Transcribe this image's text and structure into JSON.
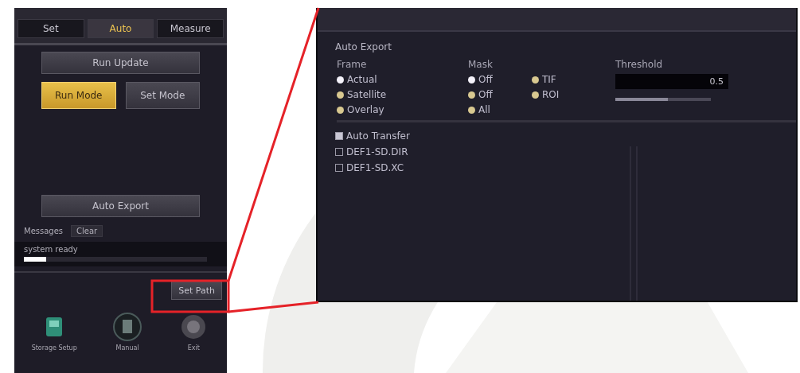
{
  "left_panel": {
    "tabs": [
      {
        "label": "Set",
        "selected": false
      },
      {
        "label": "Auto",
        "selected": true
      },
      {
        "label": "Measure",
        "selected": false
      }
    ],
    "run_button": "Run Update",
    "mode_buttons": [
      {
        "label": "Run Mode",
        "selected": true
      },
      {
        "label": "Set Mode",
        "selected": false
      }
    ],
    "export_button": "Auto Export",
    "messages": {
      "label": "Messages",
      "clear": "Clear",
      "text": "system ready",
      "level": 0.12
    },
    "path_button": "Set Path",
    "tools": [
      {
        "label": "Storage Setup",
        "kind": "storage"
      },
      {
        "label": "Manual",
        "kind": "manual"
      },
      {
        "label": "Exit",
        "kind": "exit"
      }
    ]
  },
  "callout": {
    "title": "Auto Export",
    "frame": {
      "label": "Frame",
      "options": [
        {
          "label": "Actual",
          "selected": true
        },
        {
          "label": "Satellite",
          "selected": false
        },
        {
          "label": "Overlay",
          "selected": false
        }
      ]
    },
    "mask": {
      "label": "Mask",
      "options": [
        {
          "label": "Off",
          "selected": true
        },
        {
          "label": "TIF",
          "selected": false
        },
        {
          "label": "Off",
          "selected": false
        },
        {
          "label": "ROI",
          "selected": false
        },
        {
          "label": "All",
          "selected": false
        }
      ]
    },
    "threshold": {
      "label": "Threshold",
      "value": "0.5",
      "level": 0.55
    },
    "auto_transfer": {
      "label": "Auto Transfer",
      "checked": true
    },
    "files": [
      {
        "label": "DEF1-SD.DIR",
        "checked": false
      },
      {
        "label": "DEF1-SD.XC",
        "checked": false
      }
    ]
  }
}
